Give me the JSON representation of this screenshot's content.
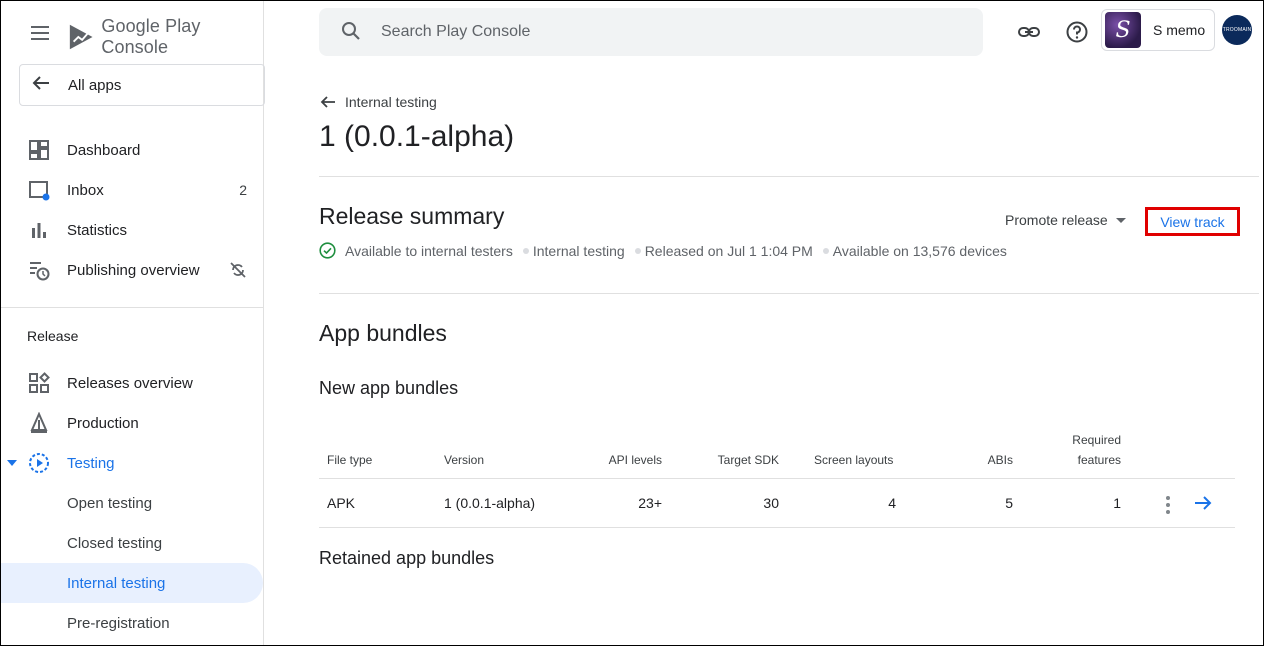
{
  "brand": {
    "name": "Google Play Console"
  },
  "sidebar": {
    "all_apps": "All apps",
    "items": [
      {
        "label": "Dashboard"
      },
      {
        "label": "Inbox",
        "count": "2"
      },
      {
        "label": "Statistics"
      },
      {
        "label": "Publishing overview"
      }
    ],
    "release_section": "Release",
    "release_items": [
      {
        "label": "Releases overview"
      },
      {
        "label": "Production"
      },
      {
        "label": "Testing"
      },
      {
        "label": "Open testing"
      },
      {
        "label": "Closed testing"
      },
      {
        "label": "Internal testing"
      },
      {
        "label": "Pre-registration"
      }
    ]
  },
  "topbar": {
    "search_placeholder": "Search Play Console",
    "account_name": "S memo",
    "app_initial": "S",
    "avatar_text": "TROOMAIN"
  },
  "main": {
    "back_label": "Internal testing",
    "title": "1 (0.0.1-alpha)",
    "release_summary": {
      "heading": "Release summary",
      "promote": "Promote release",
      "view_track": "View track",
      "status": "Available to internal testers",
      "track": "Internal testing",
      "released": "Released on Jul 1 1:04 PM",
      "devices": "Available on 13,576 devices"
    },
    "app_bundles_heading": "App bundles",
    "new_bundles_heading": "New app bundles",
    "retained_heading": "Retained app bundles",
    "table": {
      "headers": {
        "file_type": "File type",
        "version": "Version",
        "api_levels": "API levels",
        "target_sdk": "Target SDK",
        "screen_layouts": "Screen layouts",
        "abis": "ABIs",
        "required_line1": "Required",
        "required_line2": "features"
      },
      "rows": [
        {
          "file_type": "APK",
          "version": "1 (0.0.1-alpha)",
          "api_levels": "23+",
          "target_sdk": "30",
          "screen_layouts": "4",
          "abis": "5",
          "required_features": "1"
        }
      ]
    }
  },
  "colors": {
    "accent": "#1a73e8",
    "highlight": "#e00000",
    "selected_bg": "#e8f0fe",
    "success": "#1e8e3e"
  }
}
